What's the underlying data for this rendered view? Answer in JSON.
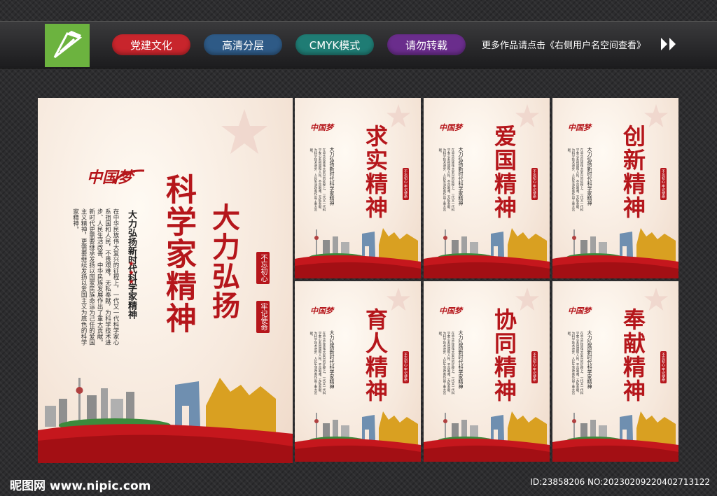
{
  "header": {
    "tags": [
      {
        "label": "党建文化",
        "color": "#c8252c"
      },
      {
        "label": "高清分层",
        "color": "#2e5a86"
      },
      {
        "label": "CMYK模式",
        "color": "#1f7c74"
      },
      {
        "label": "请勿转载",
        "color": "#6a2d8c"
      }
    ],
    "more_text": "更多作品请点击《右侧用户名空间查看》"
  },
  "main_poster": {
    "logo": "中国梦",
    "title": "科学家精神",
    "slogan": "大力弘扬",
    "subtitle": "大力弘扬新时代科学家精神",
    "seal_left": "不忘初心",
    "seal_right": "牢记使命",
    "stars": "★★★",
    "body": "在中华民族伟大复兴的征程上，一代又一代科学家心系祖国和人民，不畏艰难，无私奉献，为科学技术进步、人民生活改善、中华民族发展作出了重大贡献。新时代更需要继承发扬以国家民族命运为己任的爱国主义精神，更需要继续发扬以爱国主义为底色的科学家精神。"
  },
  "small_posters": [
    {
      "title": "求实精神",
      "logo": "中国梦",
      "subtitle": "大力弘扬新时代科学家精神",
      "seal": "不忘初心 牢记使命",
      "body": "在中华民族伟大复兴的征程上，一代又一代科学家心系祖国和人民，不畏艰难，无私奉献，为科学技术进步、人民生活改善作出了重大贡献。"
    },
    {
      "title": "爱国精神",
      "logo": "中国梦",
      "subtitle": "大力弘扬新时代科学家精神",
      "seal": "不忘初心 牢记使命",
      "body": "在中华民族伟大复兴的征程上，一代又一代科学家心系祖国和人民，不畏艰难，无私奉献，为科学技术进步、人民生活改善作出了重大贡献。"
    },
    {
      "title": "创新精神",
      "logo": "中国梦",
      "subtitle": "大力弘扬新时代科学家精神",
      "seal": "不忘初心 牢记使命",
      "body": "在中华民族伟大复兴的征程上，一代又一代科学家心系祖国和人民，不畏艰难，无私奉献，为科学技术进步、人民生活改善作出了重大贡献。"
    },
    {
      "title": "育人精神",
      "logo": "中国梦",
      "subtitle": "大力弘扬新时代科学家精神",
      "seal": "不忘初心 牢记使命",
      "body": "在中华民族伟大复兴的征程上，一代又一代科学家心系祖国和人民，不畏艰难，无私奉献，为科学技术进步、人民生活改善作出了重大贡献。"
    },
    {
      "title": "协同精神",
      "logo": "中国梦",
      "subtitle": "大力弘扬新时代科学家精神",
      "seal": "不忘初心 牢记使命",
      "body": "在中华民族伟大复兴的征程上，一代又一代科学家心系祖国和人民，不畏艰难，无私奉献，为科学技术进步、人民生活改善作出了重大贡献。"
    },
    {
      "title": "奉献精神",
      "logo": "中国梦",
      "subtitle": "大力弘扬新时代科学家精神",
      "seal": "不忘初心 牢记使命",
      "body": "在中华民族伟大复兴的征程上，一代又一代科学家心系祖国和人民，不畏艰难，无私奉献，为科学技术进步、人民生活改善作出了重大贡献。"
    }
  ],
  "footer": {
    "site": "昵图网 www.nipic.com",
    "id_text": "ID:23858206 NO:20230209220402713122"
  }
}
